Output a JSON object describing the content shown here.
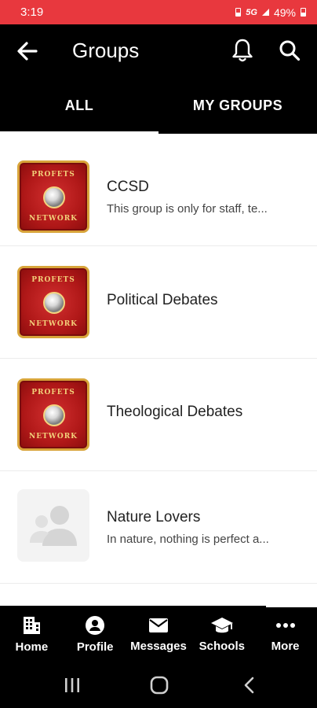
{
  "status": {
    "time": "3:19",
    "network": "5G",
    "battery": "49%"
  },
  "header": {
    "title": "Groups"
  },
  "tabs": [
    {
      "label": "ALL",
      "active": true
    },
    {
      "label": "MY GROUPS",
      "active": false
    }
  ],
  "groups": [
    {
      "name": "CCSD",
      "description": "This group is only for staff, te...",
      "logo": "profets-network-logo"
    },
    {
      "name": "Political Debates",
      "description": "",
      "logo": "profets-network-logo"
    },
    {
      "name": "Theological Debates",
      "description": "",
      "logo": "profets-network-logo"
    },
    {
      "name": "Nature Lovers",
      "description": "In nature, nothing is perfect a...",
      "logo": "group-placeholder-icon"
    }
  ],
  "logo_text": {
    "top": "PROFETS",
    "bottom": "NETWORK"
  },
  "bottom_nav": [
    {
      "label": "Home",
      "icon": "building-icon"
    },
    {
      "label": "Profile",
      "icon": "profile-icon"
    },
    {
      "label": "Messages",
      "icon": "envelope-icon"
    },
    {
      "label": "Schools",
      "icon": "graduation-cap-icon"
    },
    {
      "label": "More",
      "icon": "more-dots-icon"
    }
  ],
  "colors": {
    "status_bar": "#e8383e",
    "app_bar": "#000000",
    "logo_red": "#b01818",
    "logo_gold": "#d8a43a"
  }
}
